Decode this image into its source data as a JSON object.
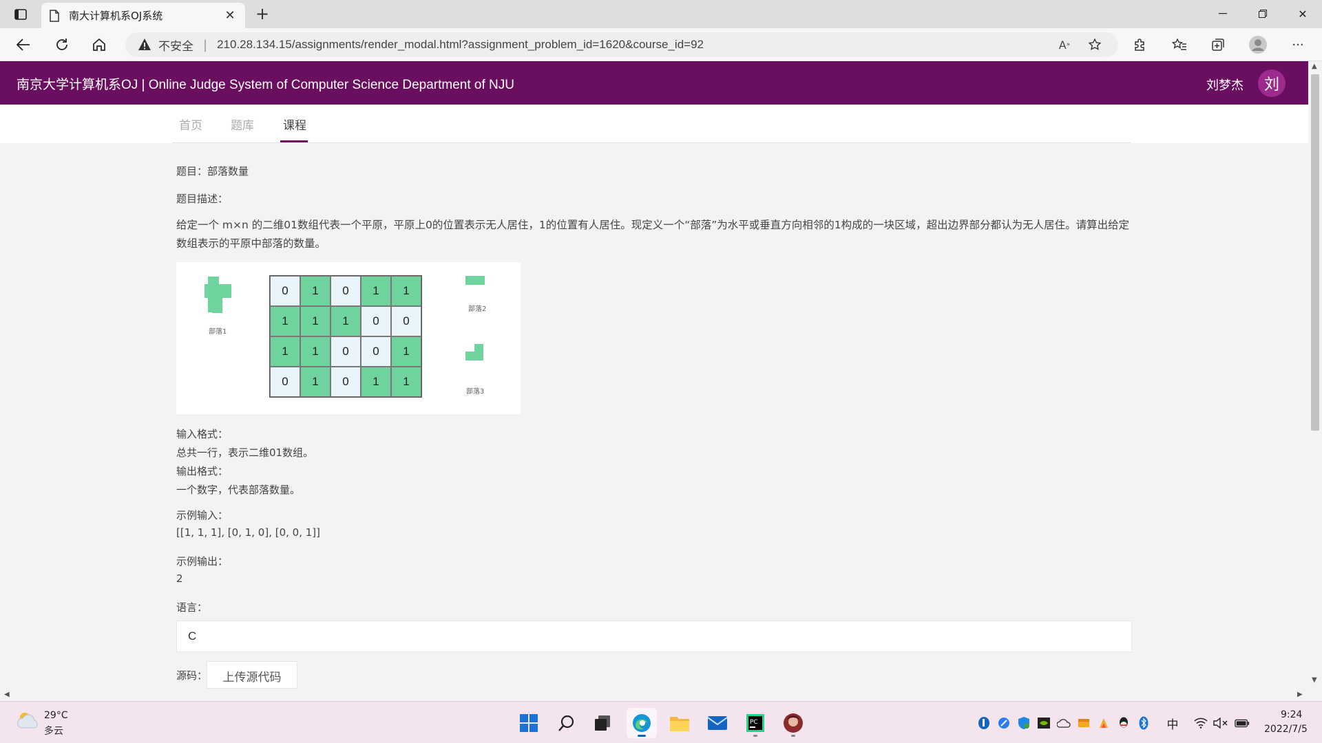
{
  "browser": {
    "tab_title": "南大计算机系OJ系统",
    "insecure_label": "不安全",
    "url": "210.28.134.15/assignments/render_modal.html?assignment_problem_id=1620&course_id=92"
  },
  "site": {
    "title": "南京大学计算机系OJ | Online Judge System of Computer Science Department of NJU",
    "user_name": "刘梦杰",
    "avatar_text": "刘",
    "brand_color": "#6a0f5f"
  },
  "nav": {
    "home": "首页",
    "problems": "题库",
    "courses": "课程"
  },
  "problem": {
    "title_label": "题目：部落数量",
    "desc_label": "题目描述：",
    "description": "给定一个 m×n 的二维01数组代表一个平原，平原上0的位置表示无人居住，1的位置有人居住。现定义一个“部落”为水平或垂直方向相邻的1构成的一块区域，超出边界部分都认为无人居住。请算出给定数组表示的平原中部落的数量。",
    "figure": {
      "grid": [
        [
          "0",
          "1",
          "0",
          "1",
          "1"
        ],
        [
          "1",
          "1",
          "1",
          "0",
          "0"
        ],
        [
          "1",
          "1",
          "0",
          "0",
          "1"
        ],
        [
          "0",
          "1",
          "0",
          "1",
          "1"
        ]
      ],
      "tribe1": "部落1",
      "tribe2": "部落2",
      "tribe3": "部落3",
      "one_color": "#6ed39c",
      "zero_color": "#eaf5fb"
    },
    "input_format_label": "输入格式：",
    "input_format": "总共一行，表示二维01数组。",
    "output_format_label": "输出格式：",
    "output_format": "一个数字，代表部落数量。",
    "sample_input_label": "示例输入：",
    "sample_input": "[[1, 1, 1], [0, 1, 0], [0, 0, 1]]",
    "sample_output_label": "示例输出：",
    "sample_output": "2",
    "language_label": "语言：",
    "language_value": "C",
    "source_label": "源码：",
    "upload_button": "上传源代码"
  },
  "taskbar": {
    "temperature": "29°C",
    "weather": "多云",
    "ime": "中",
    "time": "9:24",
    "date": "2022/7/5"
  }
}
